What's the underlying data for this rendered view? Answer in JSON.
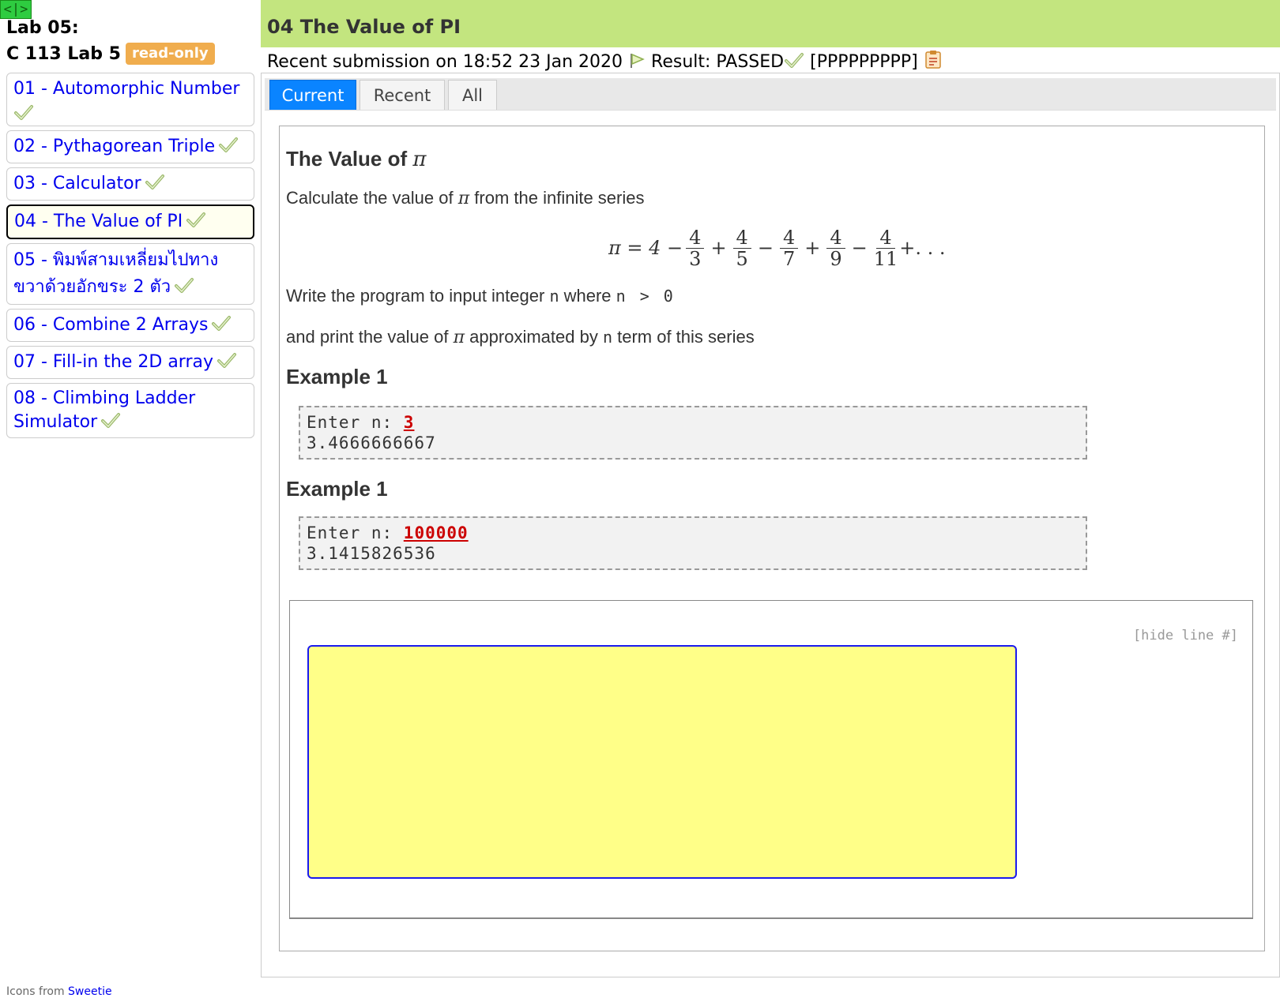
{
  "sidebar": {
    "toggle_label": "<|>",
    "lab_title": "Lab 05:",
    "course": "C 113 Lab 5",
    "badge": "read-only",
    "items": [
      {
        "label": "01 - Automorphic Number"
      },
      {
        "label": "02 - Pythagorean Triple"
      },
      {
        "label": "03 - Calculator"
      },
      {
        "label": "04 - The Value of PI"
      },
      {
        "label": "05 - พิมพ์สามเหลี่ยมไปทางขวาด้วยอักขระ 2 ตัว"
      },
      {
        "label": "06 - Combine 2 Arrays"
      },
      {
        "label": "07 - Fill-in the 2D array"
      },
      {
        "label": "08 - Climbing Ladder Simulator"
      }
    ],
    "active_index": 3
  },
  "header": {
    "title": "04 The Value of PI",
    "submission_text": "Recent submission on 18:52 23 Jan 2020",
    "result_text": "Result: PASSED",
    "result_code": "[PPPPPPPPP]"
  },
  "tabs": [
    "Current",
    "Recent",
    "All"
  ],
  "problem": {
    "title_prefix": "The Value of ",
    "pi": "π",
    "intro_before": "Calculate the value of ",
    "intro_after": " from the infinite series",
    "formula": {
      "lhs": "π = 4 −",
      "terms": [
        {
          "sign": "",
          "num": "4",
          "den": "3"
        },
        {
          "sign": "+",
          "num": "4",
          "den": "5"
        },
        {
          "sign": "−",
          "num": "4",
          "den": "7"
        },
        {
          "sign": "+",
          "num": "4",
          "den": "9"
        },
        {
          "sign": "−",
          "num": "4",
          "den": "11"
        }
      ],
      "tail": "+. . ."
    },
    "line1_a": "Write the program to input integer ",
    "line1_var": "n",
    "line1_b": " where ",
    "line1_cond": "n > 0",
    "line2_a": "and print the value of ",
    "line2_b": " approximated by ",
    "line2_var": "n",
    "line2_c": " term of this series",
    "examples": [
      {
        "heading": "Example 1",
        "prompt": "Enter n: ",
        "input": "3",
        "output": "3.4666666667"
      },
      {
        "heading": "Example 1",
        "prompt": "Enter n: ",
        "input": "100000",
        "output": "3.1415826536"
      }
    ],
    "hide_line": "[hide line #]"
  },
  "footer": {
    "text": "Icons from ",
    "link": "Sweetie"
  },
  "colors": {
    "header_bg": "#c3e57f",
    "tab_active": "#0a84ff",
    "editor_bg": "#ffff88",
    "badge": "#f0ad4e"
  }
}
